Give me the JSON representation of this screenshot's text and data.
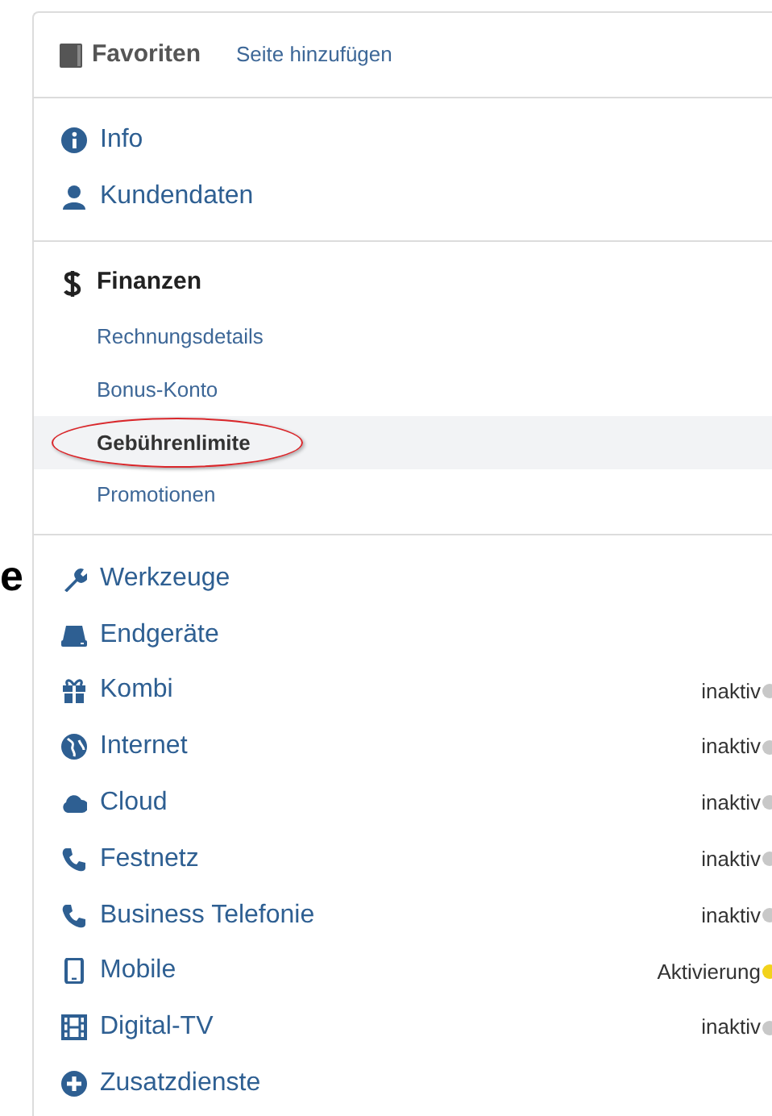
{
  "background_fragment": "e",
  "favorites": {
    "title": "Favoriten",
    "add_link": "Seite hinzufügen"
  },
  "top_items": [
    {
      "label": "Info"
    },
    {
      "label": "Kundendaten"
    }
  ],
  "finance": {
    "title": "Finanzen",
    "items": [
      {
        "label": "Rechnungsdetails",
        "selected": false,
        "circled": false
      },
      {
        "label": "Bonus-Konto",
        "selected": false,
        "circled": false
      },
      {
        "label": "Gebührenlimite",
        "selected": true,
        "circled": true
      },
      {
        "label": "Promotionen",
        "selected": false,
        "circled": false
      }
    ]
  },
  "services": [
    {
      "label": "Werkzeuge"
    },
    {
      "label": "Endgeräte"
    },
    {
      "label": "Kombi",
      "status": "inaktiv",
      "color": "#c8c8c8"
    },
    {
      "label": "Internet",
      "status": "inaktiv",
      "color": "#c8c8c8"
    },
    {
      "label": "Cloud",
      "status": "inaktiv",
      "color": "#c8c8c8"
    },
    {
      "label": "Festnetz",
      "status": "inaktiv",
      "color": "#c8c8c8"
    },
    {
      "label": "Business Telefonie",
      "status": "inaktiv",
      "color": "#c8c8c8"
    },
    {
      "label": "Mobile",
      "status": "Aktivierung",
      "color": "#f2d21b"
    },
    {
      "label": "Digital-TV",
      "status": "inaktiv",
      "color": "#c8c8c8"
    },
    {
      "label": "Zusatzdienste"
    }
  ]
}
